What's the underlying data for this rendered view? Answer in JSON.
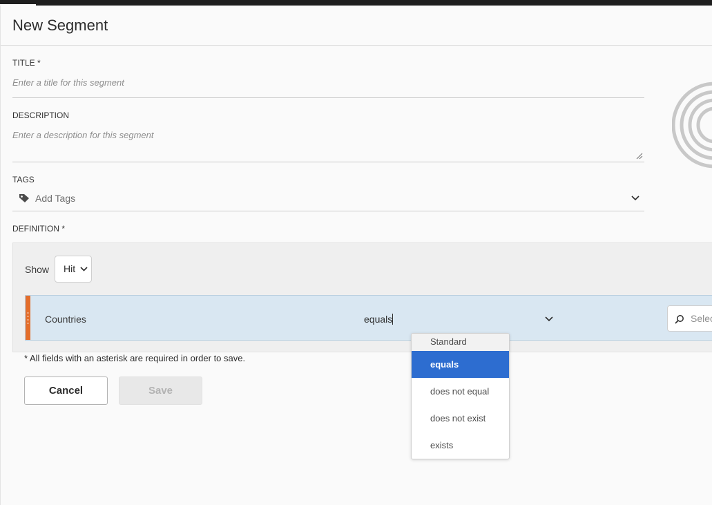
{
  "window": {
    "title": "New Segment"
  },
  "form": {
    "title": {
      "label": "TITLE *",
      "placeholder": "Enter a title for this segment"
    },
    "description": {
      "label": "DESCRIPTION",
      "placeholder": "Enter a description for this segment"
    },
    "tags": {
      "label": "TAGS",
      "placeholder": "Add Tags",
      "icon": "tag-icon"
    },
    "definition": {
      "label": "DEFINITION *",
      "show_label": "Show",
      "show_value": "Hit",
      "rule": {
        "dimension": "Countries",
        "operator": "equals",
        "value_placeholder": "Select",
        "handle_color": "#e46d2a"
      }
    }
  },
  "operator_dropdown": {
    "header": "Standard",
    "options": [
      "equals",
      "does not equal",
      "does not exist",
      "exists"
    ],
    "selected": "equals",
    "selected_color": "#2d6dd0"
  },
  "footer": {
    "required_note": "* All fields with an asterisk are required in order to save.",
    "cancel_label": "Cancel",
    "save_label": "Save"
  }
}
